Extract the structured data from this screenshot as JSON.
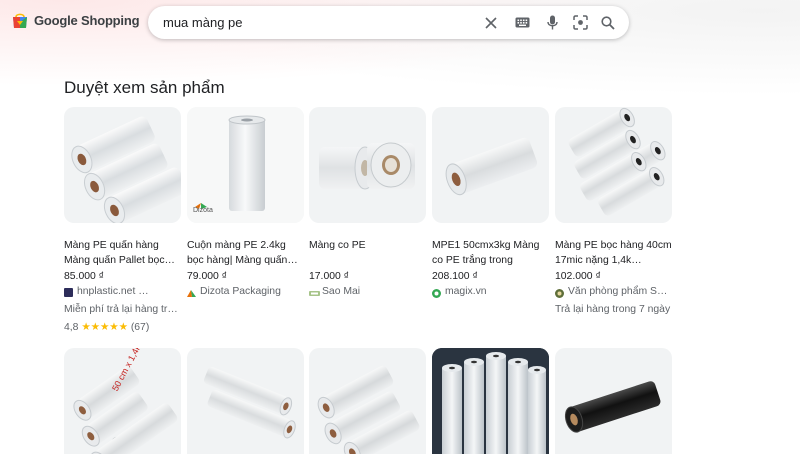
{
  "header": {
    "logo_text": "Google Shopping",
    "search_value": "mua màng pe"
  },
  "icons": {
    "clear": "close-icon",
    "keyboard": "keyboard-icon",
    "mic": "microphone-icon",
    "lens": "camera-search-icon",
    "search": "search-icon"
  },
  "section": {
    "title": "Duyệt xem sản phẩm"
  },
  "products": [
    {
      "title": "Màng PE quấn hàng Màng quấn Pallet bọc…",
      "price": "85.000 ₫",
      "store": "hnplastic.net …",
      "note": "Miễn phí trả lại hàng tr…",
      "rating": "4,8",
      "stars": "★★★★★",
      "reviews": "(67)",
      "image": "pe-stretch-film-rolls-stack"
    },
    {
      "title": "Cuộn màng PE 2.4kg bọc hàng| Màng quấn…",
      "price": "79.000 ₫",
      "store": "Dizota Packaging",
      "image_label": "Dizota",
      "image": "pe-film-single-roll-upright"
    },
    {
      "title": "Màng co PE",
      "price": "17.000 ₫",
      "store": "Sao Mai",
      "image": "pe-shrink-film-two-rolls"
    },
    {
      "title": "MPE1 50cmx3kg Màng co PE trắng trong",
      "price": "208.100 ₫",
      "store": "magix.vn",
      "image": "pe-film-roll-lying"
    },
    {
      "title": "Màng PE bọc hàng 40cm 17mic nặng 1,4k…",
      "price": "102.000 ₫",
      "store": "Văn phòng phẩm S…",
      "note": "Trả lại hàng trong 7 ngày",
      "image": "pe-film-rolls-pyramid"
    },
    {
      "image": "pe-film-rolls-labeled",
      "image_label": "50 cm x 1,4kg"
    },
    {
      "image": "pe-film-rolls-two"
    },
    {
      "image": "pe-film-rolls-three"
    },
    {
      "image": "pe-film-rolls-standing-dark-bg"
    },
    {
      "image": "black-pe-film-roll"
    }
  ],
  "colors": {
    "star": "#fbbc04",
    "card_bg": "#f1f3f4",
    "text_secondary": "#5f6368"
  }
}
